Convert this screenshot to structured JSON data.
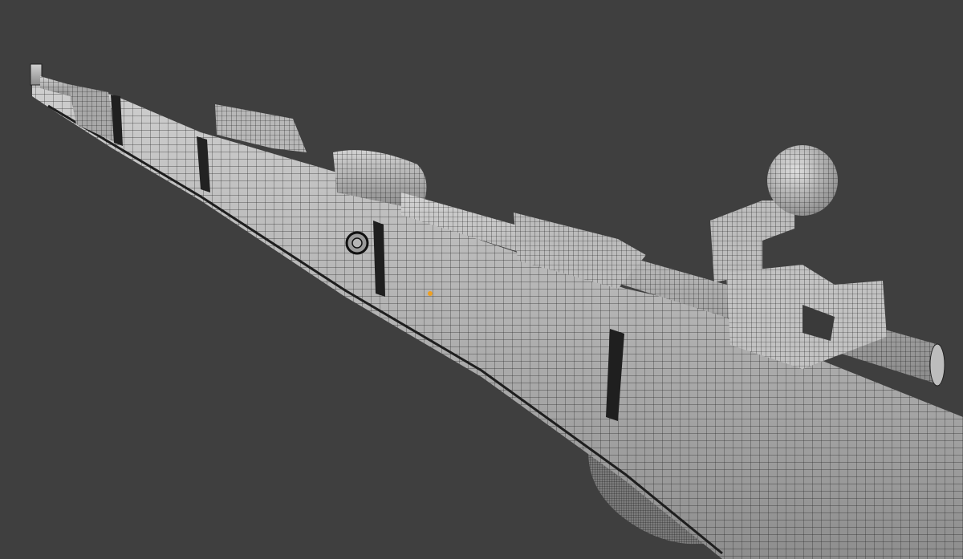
{
  "viewport": {
    "background_color": "#3f3f3f",
    "view_mode": "wireframe-on-shaded"
  },
  "model": {
    "surface_color": "#b4b4b4",
    "wire_color": "#1a1a1a",
    "selected_vertex_color": "#f0a020",
    "parts": [
      {
        "id": "muzzle",
        "kind": "cylinder"
      },
      {
        "id": "front-band",
        "kind": "block"
      },
      {
        "id": "forestock",
        "kind": "stock"
      },
      {
        "id": "rear-sight",
        "kind": "block"
      },
      {
        "id": "receiver-ring",
        "kind": "cylinder"
      },
      {
        "id": "bolt-body",
        "kind": "cylinder"
      },
      {
        "id": "bolt-handle-knob",
        "kind": "sphere"
      },
      {
        "id": "bolt-handle-arm",
        "kind": "block"
      },
      {
        "id": "cocking-piece",
        "kind": "block"
      },
      {
        "id": "trigger-guard",
        "kind": "loop"
      },
      {
        "id": "butt-stock",
        "kind": "stock"
      },
      {
        "id": "sling-swivel",
        "kind": "ring"
      }
    ]
  }
}
